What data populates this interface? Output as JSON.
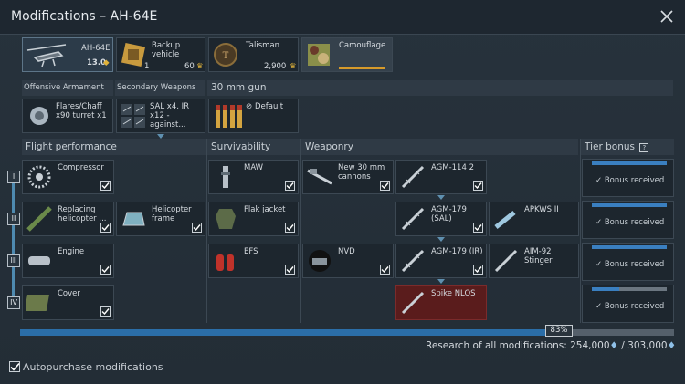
{
  "window": {
    "title": "Modifications – AH-64E"
  },
  "top_row": {
    "vehicle": {
      "name": "AH-64E",
      "br": "13.0"
    },
    "backup": {
      "label": "Backup vehicle",
      "count": "1",
      "cost": "60"
    },
    "talisman": {
      "label": "Talisman",
      "cost": "2,900"
    },
    "camouflage": {
      "label": "Camouflage"
    }
  },
  "tabs": {
    "offensive": "Offensive Armament",
    "secondary": "Secondary Weapons",
    "gun": "30 mm gun"
  },
  "weapons_row": {
    "flares": "Flares/Chaff x90 turret x1",
    "sal": "SAL x4, IR x12 - against...",
    "default": "Default"
  },
  "columns": {
    "flight": "Flight performance",
    "survivability": "Survivability",
    "weaponry": "Weaponry",
    "tier_bonus": "Tier bonus"
  },
  "tiers": [
    "I",
    "II",
    "III",
    "IV"
  ],
  "mods": {
    "compressor": "Compressor",
    "replacing_helicopter": "Replacing helicopter ...",
    "helicopter_frame": "Helicopter frame",
    "engine": "Engine",
    "cover": "Cover",
    "maw": "MAW",
    "flak_jacket": "Flak jacket",
    "efs": "EFS",
    "new_30mm": "New 30 mm cannons",
    "nvd": "NVD",
    "agm114": "AGM-114 2",
    "agm179_sal": "AGM-179 (SAL)",
    "apkws": "APKWS II",
    "agm179_ir": "AGM-179 (IR)",
    "aim92": "AIM-92 Stinger",
    "spike": "Spike NLOS"
  },
  "bonus_text": "Bonus received",
  "progress": {
    "percent_label": "83%",
    "value": 0.83
  },
  "research": {
    "label": "Research of all modifications: 254,000",
    "total": " / 303,000"
  },
  "autopurchase": {
    "label": "Autopurchase modifications"
  },
  "colors": {
    "accent": "#2b6ea8",
    "locked": "#5a1c1c",
    "gold": "#e0b23a"
  }
}
